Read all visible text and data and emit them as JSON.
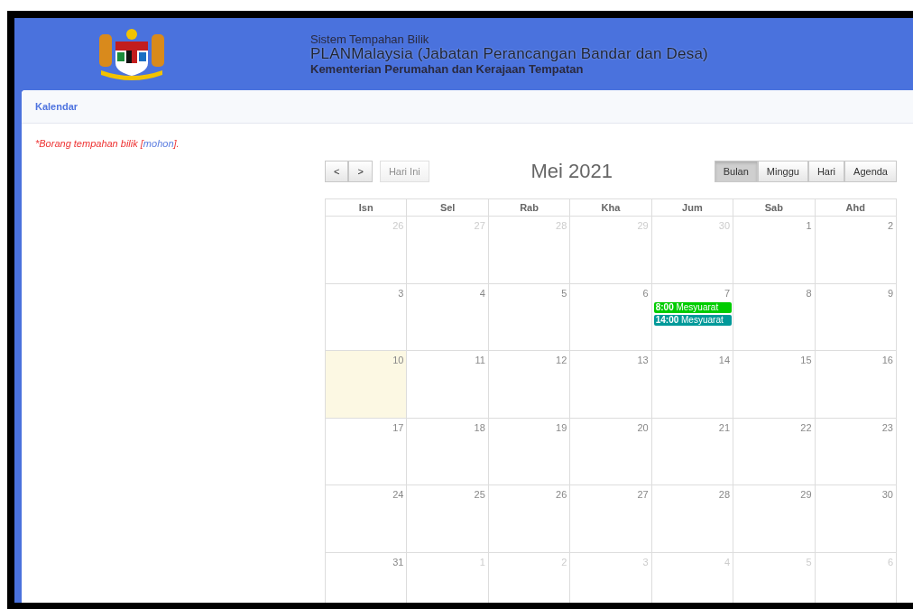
{
  "header": {
    "line_1": "Sistem Tempahan Bilik",
    "line_2": "PLANMalaysia (Jabatan Perancangan Bandar dan Desa)",
    "line_3": "Kementerian Perumahan dan Kerajaan Tempatan"
  },
  "card": {
    "title": "Kalendar",
    "note_before": "*Borang tempahan bilik [",
    "note_link": "mohon",
    "note_after": "]."
  },
  "calendar": {
    "prev": "<",
    "next": ">",
    "today_button": {
      "label": "Hari Ini",
      "disabled": true
    },
    "title": "Mei 2021",
    "views": [
      {
        "label": "Bulan",
        "selected": true
      },
      {
        "label": "Minggu",
        "selected": false
      },
      {
        "label": "Hari",
        "selected": false
      },
      {
        "label": "Agenda",
        "selected": false
      }
    ],
    "weekdays": [
      "Isn",
      "Sel",
      "Rab",
      "Kha",
      "Jum",
      "Sab",
      "Ahd"
    ],
    "weeks": [
      [
        {
          "day": "26",
          "other_month": true,
          "today": false
        },
        {
          "day": "27",
          "other_month": true,
          "today": false
        },
        {
          "day": "28",
          "other_month": true,
          "today": false
        },
        {
          "day": "29",
          "other_month": true,
          "today": false
        },
        {
          "day": "30",
          "other_month": true,
          "today": false
        },
        {
          "day": "1",
          "other_month": false,
          "today": false
        },
        {
          "day": "2",
          "other_month": false,
          "today": false
        }
      ],
      [
        {
          "day": "3",
          "other_month": false,
          "today": false
        },
        {
          "day": "4",
          "other_month": false,
          "today": false
        },
        {
          "day": "5",
          "other_month": false,
          "today": false
        },
        {
          "day": "6",
          "other_month": false,
          "today": false
        },
        {
          "day": "7",
          "other_month": false,
          "today": false,
          "events": [
            {
              "time": "8:00",
              "title": "Mesyuarat",
              "color": "#00cc00"
            },
            {
              "time": "14:00",
              "title": "Mesyuarat",
              "color": "#009999"
            }
          ]
        },
        {
          "day": "8",
          "other_month": false,
          "today": false
        },
        {
          "day": "9",
          "other_month": false,
          "today": false
        }
      ],
      [
        {
          "day": "10",
          "other_month": false,
          "today": true
        },
        {
          "day": "11",
          "other_month": false,
          "today": false
        },
        {
          "day": "12",
          "other_month": false,
          "today": false
        },
        {
          "day": "13",
          "other_month": false,
          "today": false
        },
        {
          "day": "14",
          "other_month": false,
          "today": false
        },
        {
          "day": "15",
          "other_month": false,
          "today": false
        },
        {
          "day": "16",
          "other_month": false,
          "today": false
        }
      ],
      [
        {
          "day": "17",
          "other_month": false,
          "today": false
        },
        {
          "day": "18",
          "other_month": false,
          "today": false
        },
        {
          "day": "19",
          "other_month": false,
          "today": false
        },
        {
          "day": "20",
          "other_month": false,
          "today": false
        },
        {
          "day": "21",
          "other_month": false,
          "today": false
        },
        {
          "day": "22",
          "other_month": false,
          "today": false
        },
        {
          "day": "23",
          "other_month": false,
          "today": false
        }
      ],
      [
        {
          "day": "24",
          "other_month": false,
          "today": false
        },
        {
          "day": "25",
          "other_month": false,
          "today": false
        },
        {
          "day": "26",
          "other_month": false,
          "today": false
        },
        {
          "day": "27",
          "other_month": false,
          "today": false
        },
        {
          "day": "28",
          "other_month": false,
          "today": false
        },
        {
          "day": "29",
          "other_month": false,
          "today": false
        },
        {
          "day": "30",
          "other_month": false,
          "today": false
        }
      ],
      [
        {
          "day": "31",
          "other_month": false,
          "today": false
        },
        {
          "day": "1",
          "other_month": true,
          "today": false
        },
        {
          "day": "2",
          "other_month": true,
          "today": false
        },
        {
          "day": "3",
          "other_month": true,
          "today": false
        },
        {
          "day": "4",
          "other_month": true,
          "today": false
        },
        {
          "day": "5",
          "other_month": true,
          "today": false
        },
        {
          "day": "6",
          "other_month": true,
          "today": false
        }
      ]
    ]
  }
}
